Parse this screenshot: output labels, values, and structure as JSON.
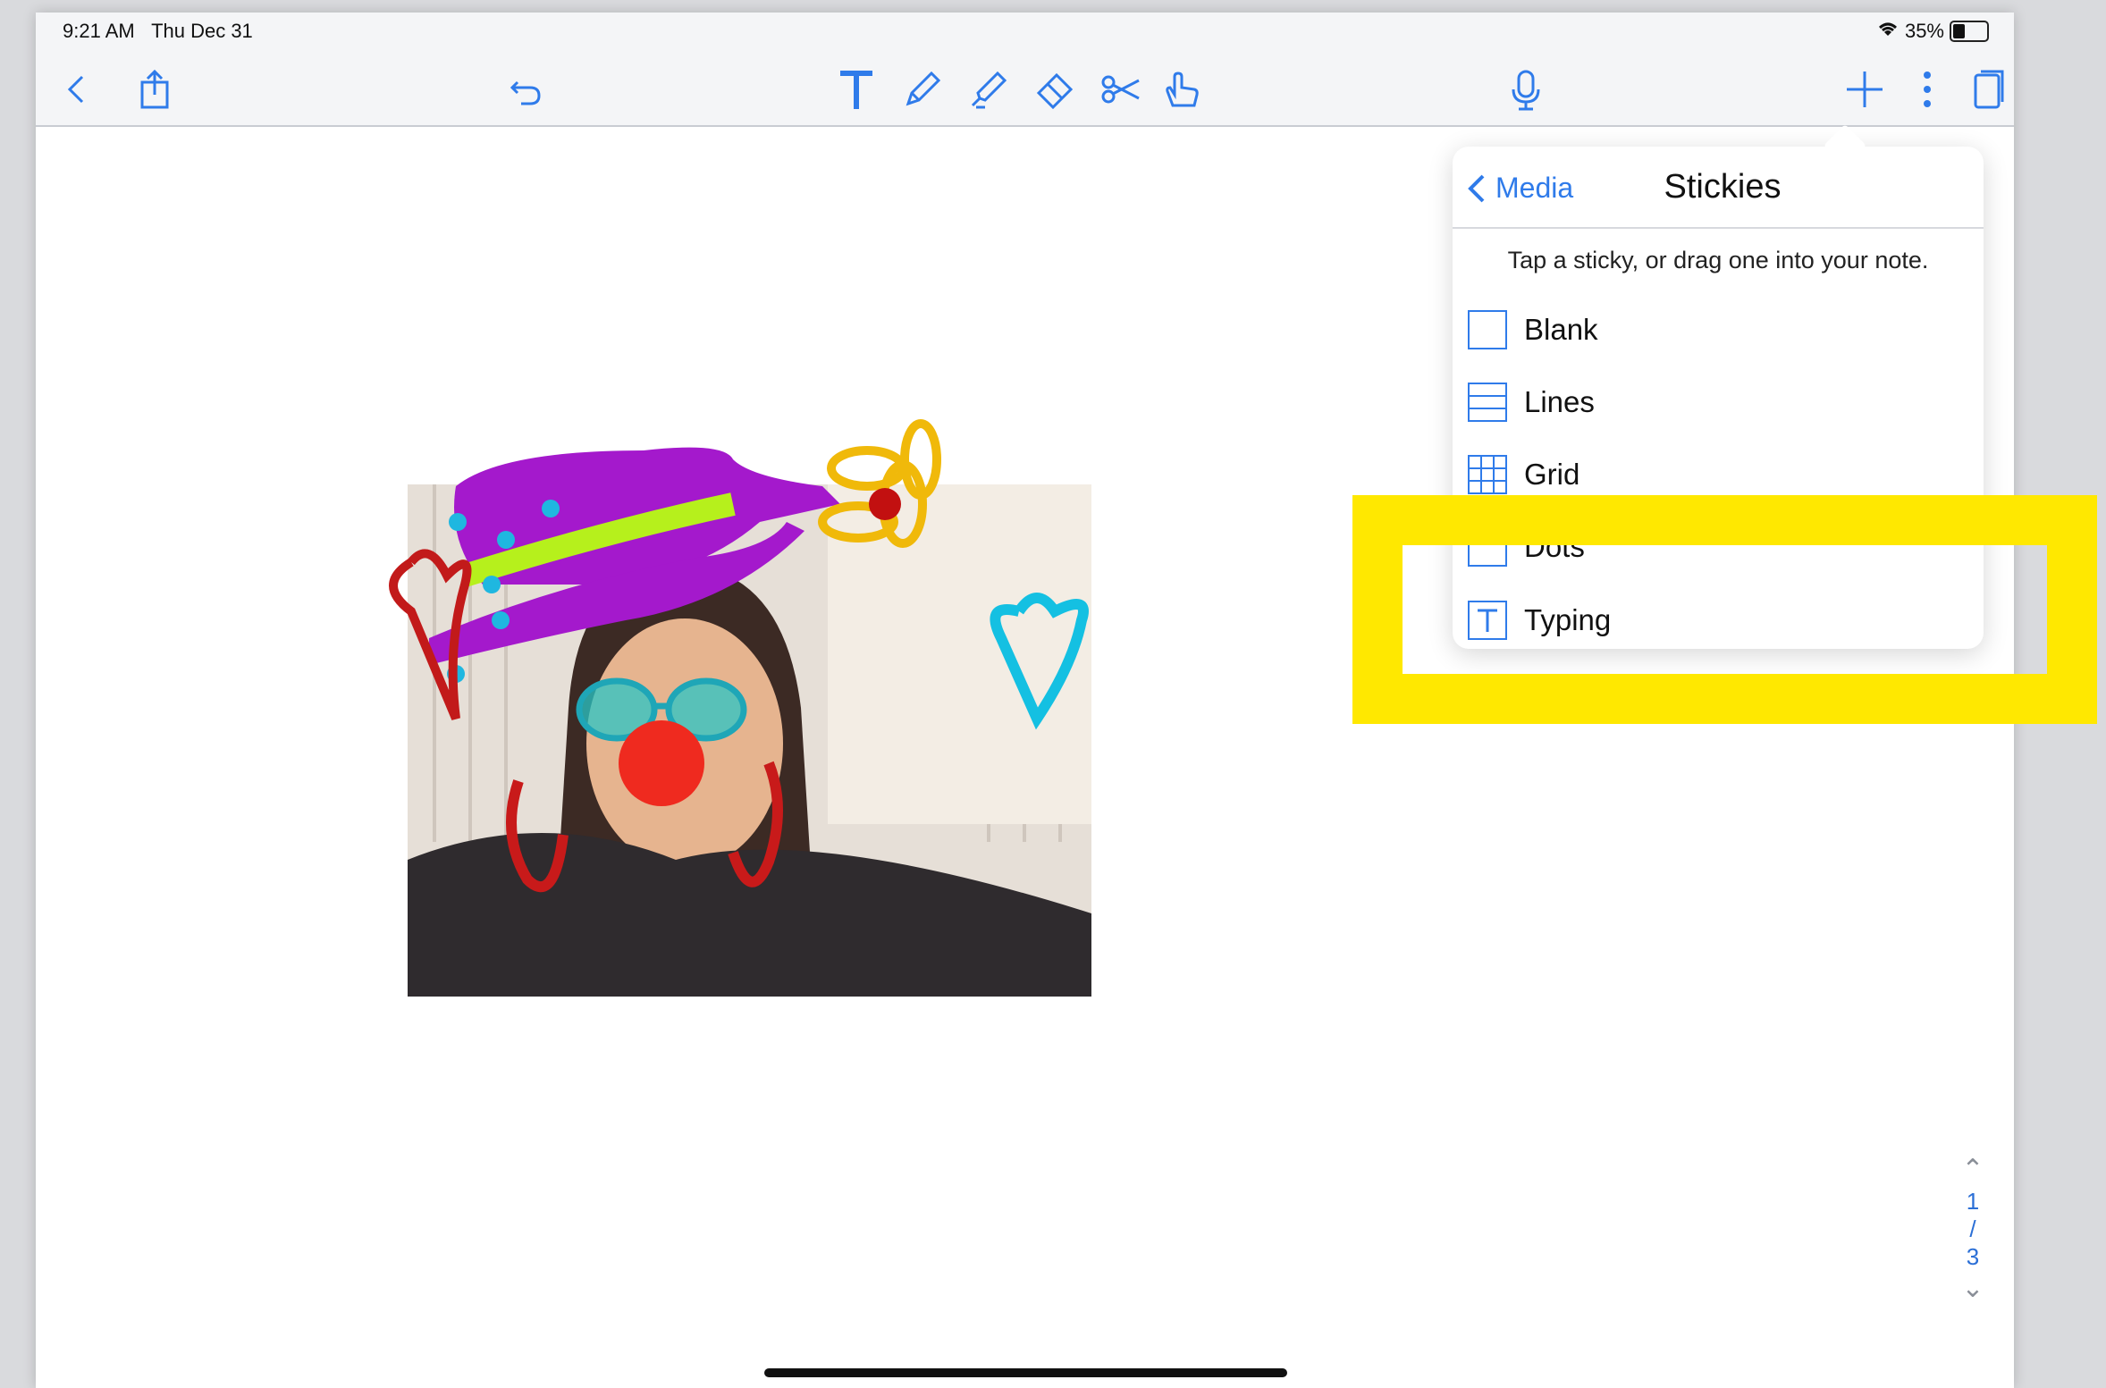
{
  "status_bar": {
    "time": "9:21 AM",
    "date": "Thu Dec 31",
    "battery": "35%"
  },
  "toolbar": {
    "icons": [
      "back-chevron-icon",
      "share-icon",
      "undo-icon",
      "text-tool-icon",
      "pen-tool-icon",
      "highlighter-tool-icon",
      "eraser-tool-icon",
      "scissors-tool-icon",
      "hand-pointer-icon",
      "microphone-icon",
      "plus-icon",
      "more-options-icon",
      "pages-icon"
    ]
  },
  "popover": {
    "back_label": "Media",
    "title": "Stickies",
    "hint": "Tap a sticky, or drag one into your note.",
    "items": [
      {
        "label": "Blank",
        "icon": "blank-sticky-icon"
      },
      {
        "label": "Lines",
        "icon": "lines-sticky-icon"
      },
      {
        "label": "Grid",
        "icon": "grid-sticky-icon"
      },
      {
        "label": "Dots",
        "icon": "dots-sticky-icon"
      },
      {
        "label": "Typing",
        "icon": "typing-sticky-icon"
      }
    ]
  },
  "page_nav": {
    "current": "1",
    "separator": "/",
    "total": "3"
  },
  "colors": {
    "accent": "#2f7bea",
    "highlight": "#ffe800"
  }
}
